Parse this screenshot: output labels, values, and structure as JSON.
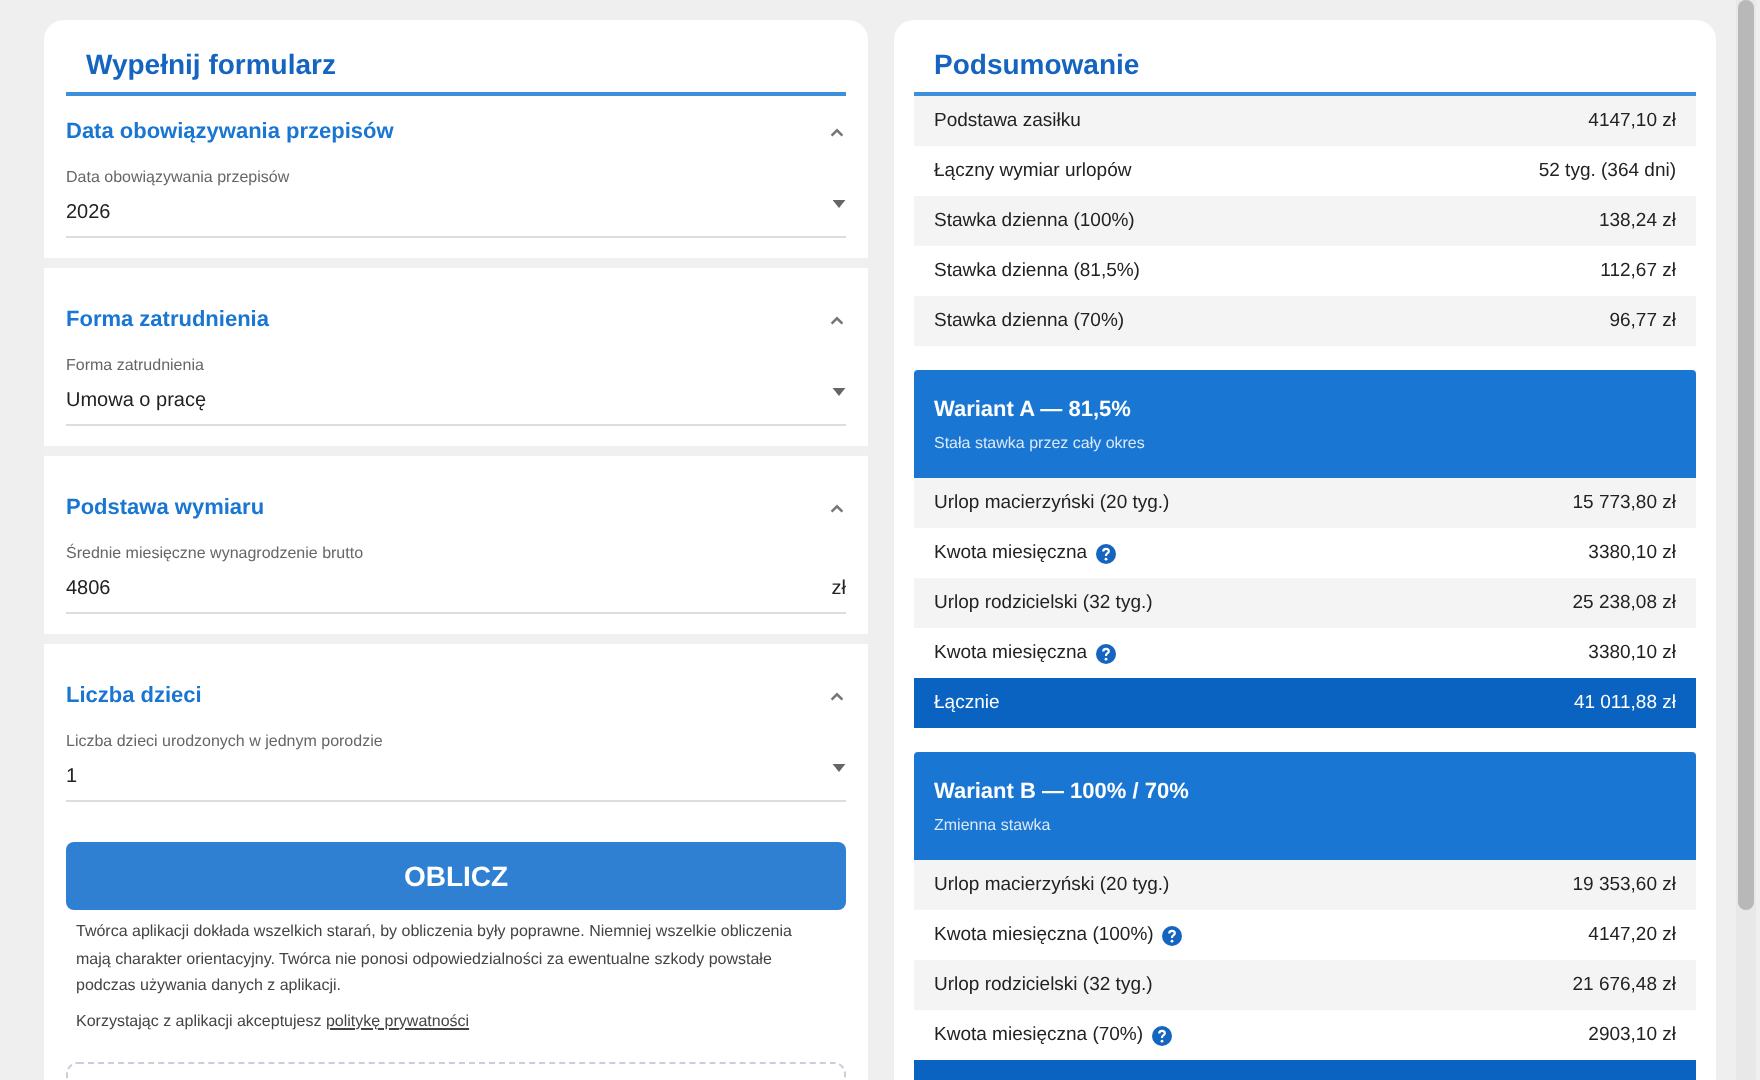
{
  "form": {
    "title": "Wypełnij formularz",
    "sections": [
      {
        "title": "Data obowiązywania przepisów",
        "expanded": true,
        "field": {
          "kind": "select",
          "label": "Data obowiązywania przepisów",
          "value": "2026"
        }
      },
      {
        "title": "Forma zatrudnienia",
        "expanded": true,
        "field": {
          "kind": "select",
          "label": "Forma zatrudnienia",
          "value": "Umowa o pracę"
        }
      },
      {
        "title": "Podstawa wymiaru",
        "expanded": true,
        "field": {
          "kind": "text",
          "label": "Średnie miesięczne wynagrodzenie brutto",
          "value": "4806",
          "suffix": "zł"
        }
      },
      {
        "title": "Liczba dzieci",
        "expanded": true,
        "field": {
          "kind": "select",
          "label": "Liczba dzieci urodzonych w jednym porodzie",
          "value": "1"
        }
      }
    ],
    "button": "OBLICZ",
    "disclaimer": "Twórca aplikacji dokłada wszelkich starań, by obliczenia były poprawne. Niemniej wszelkie obliczenia mają charakter orientacyjny. Twórca nie ponosi odpowiedzialności za ewentualne szkody powstałe podczas używania danych z aplikacji.",
    "consent": {
      "text": "Korzystając z aplikacji akceptujesz",
      "link": "politykę prywatności"
    }
  },
  "summary": {
    "title": "Podsumowanie",
    "rows": [
      {
        "label": "Podstawa zasiłku",
        "value": "4147,10 zł"
      },
      {
        "label": "Łączny wymiar urlopów",
        "value": "52 tyg. (364 dni)"
      },
      {
        "label": "Stawka dzienna (100%)",
        "value": "138,24 zł"
      },
      {
        "label": "Stawka dzienna (81,5%)",
        "value": "112,67 zł"
      },
      {
        "label": "Stawka dzienna (70%)",
        "value": "96,77 zł"
      }
    ],
    "variants": [
      {
        "title": "Wariant A — 81,5%",
        "subtitle": "Stała stawka przez cały okres",
        "rows": [
          {
            "label": "Urlop macierzyński (20 tyg.)",
            "value": "15 773,80 zł",
            "info": false
          },
          {
            "label": "Kwota miesięczna",
            "value": "3380,10 zł",
            "info": true
          },
          {
            "label": "Urlop rodzicielski (32 tyg.)",
            "value": "25 238,08 zł",
            "info": false
          },
          {
            "label": "Kwota miesięczna",
            "value": "3380,10 zł",
            "info": true
          }
        ],
        "total": {
          "label": "Łącznie",
          "value": "41 011,88 zł"
        }
      },
      {
        "title": "Wariant B — 100% / 70%",
        "subtitle": "Zmienna stawka",
        "rows": [
          {
            "label": "Urlop macierzyński (20 tyg.)",
            "value": "19 353,60 zł",
            "info": false
          },
          {
            "label": "Kwota miesięczna (100%)",
            "value": "4147,20 zł",
            "info": true
          },
          {
            "label": "Urlop rodzicielski (32 tyg.)",
            "value": "21 676,48 zł",
            "info": false
          },
          {
            "label": "Kwota miesięczna (70%)",
            "value": "2903,10 zł",
            "info": true
          }
        ]
      }
    ]
  }
}
